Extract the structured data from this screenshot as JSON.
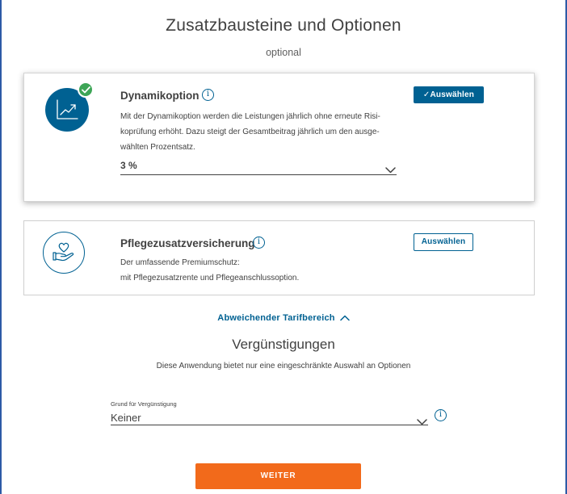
{
  "header": {
    "title": "Zusatzbausteine und Optionen",
    "subtitle": "optional"
  },
  "options": [
    {
      "title": "Dynamikoption",
      "info_symbol": "i",
      "description_lines": [
        "Mit der Dynamikoption werden die Leistungen jährlich ohne erneute Risi-",
        "koprüfung erhöht. Dazu steigt der Gesamtbeitrag jährlich um den ausge-",
        "wählten Prozentsatz."
      ],
      "select_value": "3 %",
      "button_label": "✓Auswählen",
      "selected": true,
      "icon": "chart-trend-icon",
      "badge_icon": "check-icon"
    },
    {
      "title": "Pflegezusatzversicherung",
      "info_symbol": "i",
      "description_lines": [
        "Der umfassende Premiumschutz:",
        "mit Pflegezusatzrente und Pflegeanschlussoption."
      ],
      "button_label": "Auswählen",
      "selected": false,
      "icon": "hand-heart-icon"
    }
  ],
  "tarif_link": "Abweichender Tarifbereich",
  "discounts": {
    "title": "Vergünstigungen",
    "description": "Diese Anwendung bietet nur eine eingeschränkte Auswahl an Optionen",
    "field_label": "Grund für Vergünstigung",
    "field_value": "Keiner",
    "info_symbol": "i"
  },
  "next_button": "WEITER",
  "colors": {
    "brand_blue": "#006192",
    "accent_orange": "#f26a1b",
    "check_green": "#3da556",
    "frame_border": "#2d5aa6"
  }
}
